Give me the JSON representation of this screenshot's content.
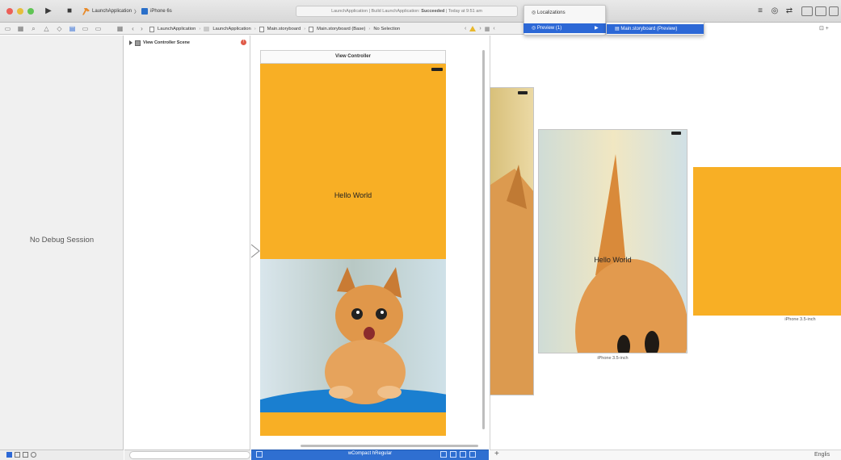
{
  "toolbar": {
    "scheme": "LaunchApplication",
    "device": "iPhone 6s",
    "activity_prefix": "LaunchApplication",
    "activity_status": "Build LaunchApplication: ",
    "activity_result": "Succeeded",
    "activity_time": "Today at 9:51 am"
  },
  "jumpbar": {
    "crumbs": [
      "LaunchApplication",
      "LaunchApplication",
      "Main.storyboard",
      "Main.storyboard (Base)",
      "No Selection"
    ]
  },
  "debug": {
    "empty_label": "No Debug Session"
  },
  "outline": {
    "scene_label": "View Controller Scene"
  },
  "canvas": {
    "vc_title": "View Controller",
    "hello": "Hello World",
    "size_class": "wCompact hRegular"
  },
  "preview": {
    "hello": "Hello World",
    "label_mid": "iPhone 3.5-inch",
    "label_right": "iPhone 3.5-inch",
    "language": "Englis"
  },
  "menus": {
    "localizations": "Localizations",
    "preview": "Preview (1)",
    "preview_file": "Main.storyboard (Preview)"
  },
  "colors": {
    "accent": "#f8af25",
    "selection": "#2c68d6"
  }
}
